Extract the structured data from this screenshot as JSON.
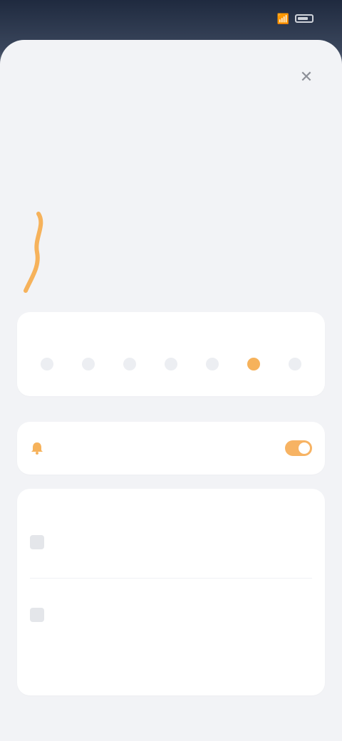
{
  "status_bar": {
    "time": "",
    "signal": "",
    "battery_label": ""
  },
  "sheet": {
    "title": "",
    "close_icon": "close-icon"
  },
  "hero": {
    "label": "",
    "value": "",
    "sub": ""
  },
  "weekly": {
    "title": "",
    "days": [
      "",
      "",
      "",
      "",
      "",
      "",
      ""
    ]
  },
  "reminder": {
    "label": "",
    "enabled": true
  },
  "goals": {
    "title": "",
    "items": [
      {
        "name": "",
        "sub": "",
        "value": ""
      },
      {
        "name": "",
        "sub": "",
        "value": ""
      }
    ]
  },
  "colors": {
    "accent": "#f6b25b",
    "sheet_bg": "#f2f3f6",
    "card_bg": "#ffffff",
    "text_dark": "#1f2126"
  },
  "icons": {
    "streak": "streak-icon",
    "bell": "bell-icon",
    "goal": "goal-icon"
  }
}
